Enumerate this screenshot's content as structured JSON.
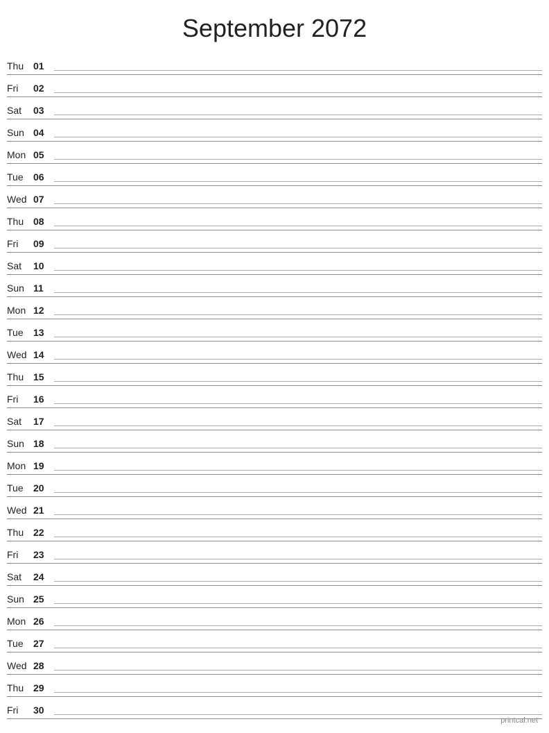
{
  "title": "September 2072",
  "footer": "printcal.net",
  "days": [
    {
      "name": "Thu",
      "number": "01"
    },
    {
      "name": "Fri",
      "number": "02"
    },
    {
      "name": "Sat",
      "number": "03"
    },
    {
      "name": "Sun",
      "number": "04"
    },
    {
      "name": "Mon",
      "number": "05"
    },
    {
      "name": "Tue",
      "number": "06"
    },
    {
      "name": "Wed",
      "number": "07"
    },
    {
      "name": "Thu",
      "number": "08"
    },
    {
      "name": "Fri",
      "number": "09"
    },
    {
      "name": "Sat",
      "number": "10"
    },
    {
      "name": "Sun",
      "number": "11"
    },
    {
      "name": "Mon",
      "number": "12"
    },
    {
      "name": "Tue",
      "number": "13"
    },
    {
      "name": "Wed",
      "number": "14"
    },
    {
      "name": "Thu",
      "number": "15"
    },
    {
      "name": "Fri",
      "number": "16"
    },
    {
      "name": "Sat",
      "number": "17"
    },
    {
      "name": "Sun",
      "number": "18"
    },
    {
      "name": "Mon",
      "number": "19"
    },
    {
      "name": "Tue",
      "number": "20"
    },
    {
      "name": "Wed",
      "number": "21"
    },
    {
      "name": "Thu",
      "number": "22"
    },
    {
      "name": "Fri",
      "number": "23"
    },
    {
      "name": "Sat",
      "number": "24"
    },
    {
      "name": "Sun",
      "number": "25"
    },
    {
      "name": "Mon",
      "number": "26"
    },
    {
      "name": "Tue",
      "number": "27"
    },
    {
      "name": "Wed",
      "number": "28"
    },
    {
      "name": "Thu",
      "number": "29"
    },
    {
      "name": "Fri",
      "number": "30"
    }
  ]
}
